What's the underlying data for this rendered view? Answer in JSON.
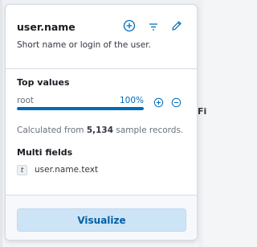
{
  "popover": {
    "field_name": "user.name",
    "description": "Short name or login of the user.",
    "header_icons": [
      "plus-circle-icon",
      "filter-icon",
      "pencil-icon"
    ]
  },
  "top_values": {
    "title": "Top values",
    "items": [
      {
        "value": "root",
        "percent_label": "100%",
        "fraction": 1.0
      }
    ],
    "calc_prefix": "Calculated from ",
    "sample_count": "5,134",
    "calc_suffix": " sample records."
  },
  "multi_fields": {
    "title": "Multi fields",
    "items": [
      {
        "type_glyph": "t",
        "name": "user.name.text"
      }
    ]
  },
  "footer": {
    "visualize_label": "Visualize"
  },
  "background": {
    "partial_text": "Fi"
  },
  "colors": {
    "accent": "#006bb8",
    "button_bg": "#cce4f5",
    "button_text": "#0061a6"
  }
}
